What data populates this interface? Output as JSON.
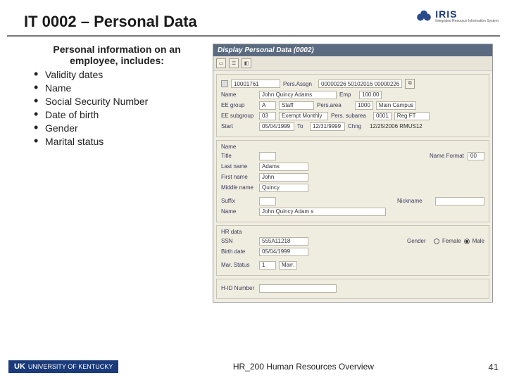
{
  "slide": {
    "title": "IT 0002 – Personal Data",
    "footer_title": "HR_200 Human Resources Overview",
    "page_number": "41"
  },
  "branding": {
    "iris_label": "IRIS",
    "iris_sub": "Integrated Resource Information System",
    "uk_mark": "UK",
    "uk_name": "UNIVERSITY OF KENTUCKY"
  },
  "left": {
    "intro": "Personal information on an employee, includes:",
    "items": [
      "Validity dates",
      "Name",
      "Social Security Number",
      "Date of birth",
      "Gender",
      "Marital status"
    ]
  },
  "sap": {
    "window_title": "Display Personal Data (0002)",
    "header": {
      "name_label": "Name",
      "name_value": "John Quincy Adams",
      "persassgn_label": "Pers.Assgn",
      "persassgn_value": "00000226 50102016 00000226",
      "persno_icon": "⧉",
      "persid_label": "",
      "persid_value": "10001761",
      "emp_label": "Emp",
      "emp_value": "100.00",
      "eegroup_label": "EE group",
      "eegroup_code": "A",
      "eegroup_value": "Staff",
      "persarea_label": "Pers.area",
      "persarea_code": "1000",
      "persarea_value": "Main Campus",
      "eesubgroup_label": "EE subgroup",
      "eesubgroup_code": "03",
      "eesubgroup_value": "Exempt Monthly",
      "perssubarea_label": "Pers. subarea",
      "perssubarea_code": "0001",
      "perssubarea_value": "Reg FT",
      "start_label": "Start",
      "start_value": "05/04/1999",
      "to_label": "To",
      "to_value": "12/31/9999",
      "chng_label": "Chng",
      "chng_value": "12/25/2006  RMUS12"
    },
    "name_block": {
      "group": "Name",
      "title_label": "Title",
      "title_value": "",
      "nameformat_label": "Name Format",
      "nameformat_value": "00",
      "lastname_label": "Last name",
      "lastname_value": "Adams",
      "firstname_label": "First name",
      "firstname_value": "John",
      "middlename_label": "Middle name",
      "middlename_value": "Quincy",
      "suffix_label": "Suffix",
      "suffix_value": "",
      "nickname_label": "Nickname",
      "nickname_value": "",
      "fullname_label": "Name",
      "fullname_value": "John Quincy Adam s"
    },
    "hr_block": {
      "group": "HR data",
      "ssn_label": "SSN",
      "ssn_value": "555A11218",
      "gender_label": "Gender",
      "gender_female": "Female",
      "gender_male": "Male",
      "birthdate_label": "Birth date",
      "birthdate_value": "05/04/1999",
      "marstatus_label": "Mar. Status",
      "marstatus_code": "1",
      "marstatus_value": "Marr."
    },
    "idnum_block": {
      "label": "H-ID Number",
      "value": ""
    }
  }
}
